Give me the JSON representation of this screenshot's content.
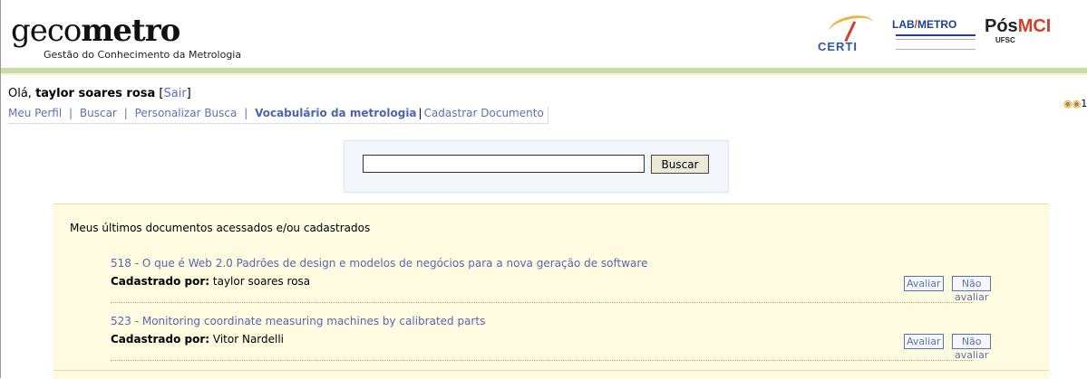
{
  "header": {
    "logo_light": "geco",
    "logo_bold": "metro",
    "tagline": "Gestão do Conhecimento da Metrologia",
    "partners": {
      "certi": "CERTI",
      "labmetro_lab": "LAB",
      "labmetro_metro": "METRO",
      "posmci_pos": "Pós",
      "posmci_mci": "MCI",
      "posmci_ufsc": "UFSC"
    }
  },
  "user": {
    "greeting": "Olá,",
    "name": "taylor soares rosa",
    "sair_open": "[",
    "sair": "Sair",
    "sair_close": "]"
  },
  "nav": {
    "items": [
      "Meu Perfil",
      "Buscar",
      "Personalizar Busca",
      "Vocabulário da metrologia",
      "Cadastrar Documento"
    ],
    "separator": "|"
  },
  "counter": {
    "icon": "binoculars-icon",
    "value": "1"
  },
  "search": {
    "value": "",
    "button_label": "Buscar"
  },
  "docs": {
    "title": "Meus últimos documentos acessados e/ou cadastrados",
    "items": [
      {
        "title": "518 - O que é Web 2.0 Padrões de design e modelos de negócios para a nova geração de software",
        "label": "Cadastrado por:",
        "author": "taylor soares rosa",
        "avaliar": "Avaliar",
        "nao_avaliar": "Não avaliar"
      },
      {
        "title": "523 - Monitoring coordinate measuring machines by calibrated parts",
        "label": "Cadastrado por:",
        "author": "Vitor Nardelli",
        "avaliar": "Avaliar",
        "nao_avaliar": "Não avaliar"
      }
    ]
  },
  "colors": {
    "link": "#5a72b5",
    "panel": "#fffbe0",
    "stripe": "#c8dca4"
  }
}
